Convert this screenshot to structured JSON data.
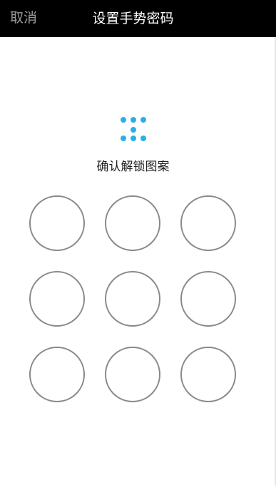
{
  "header": {
    "cancel_label": "取消",
    "title": "设置手势密码"
  },
  "instruction": "确认解锁图案",
  "colors": {
    "topbar_bg": "#000000",
    "title_text": "#ffffff",
    "cancel_text": "#9a9a9a",
    "accent_blue": "#29b0e6",
    "node_border": "#8a8a8a"
  },
  "icons": {
    "pattern_preview": "pattern-preview-icon"
  }
}
